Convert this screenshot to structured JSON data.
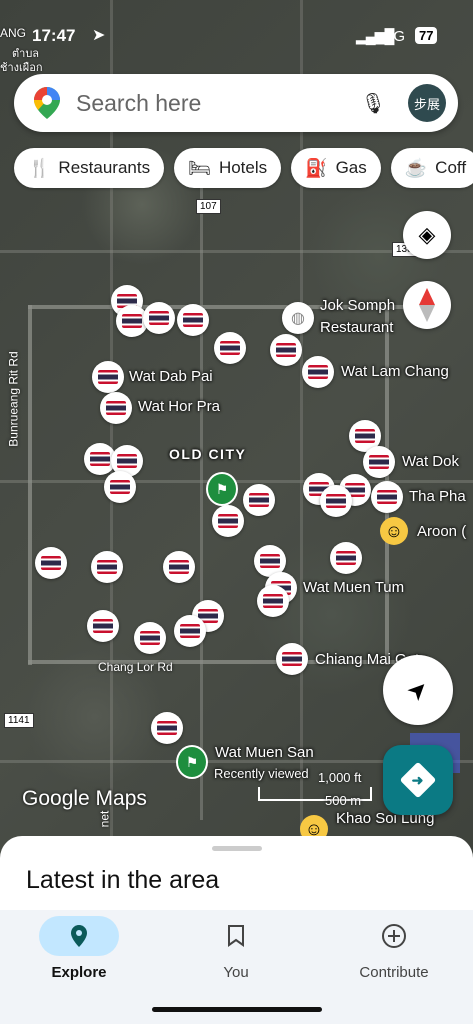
{
  "status_bar": {
    "time": "17:47",
    "carrier_top": "ANG",
    "carrier_thai1": "ตำบล",
    "carrier_thai2": "ช้างเผือก",
    "network": "5G",
    "battery": "77"
  },
  "search": {
    "placeholder": "Search here",
    "avatar_text": "步展"
  },
  "chips": [
    {
      "label": "Restaurants",
      "icon": "fork-knife-icon"
    },
    {
      "label": "Hotels",
      "icon": "bed-icon"
    },
    {
      "label": "Gas",
      "icon": "gas-pump-icon"
    },
    {
      "label": "Coff",
      "icon": "coffee-icon"
    }
  ],
  "map_labels": {
    "jok_1": "Jok Somph",
    "jok_2": "Restaurant",
    "wat_dab_pai": "Wat Dab Pai",
    "wat_lam_chang": "Wat Lam Chang",
    "wat_hor_pra": "Wat Hor Pra",
    "old_city": "OLD CITY",
    "wat_dok": "Wat Dok",
    "tha_pha": "Tha Pha",
    "aroon": "Aroon (",
    "wat_muen_tum": "Wat Muen Tum",
    "chiang_mai": "Chiang Mai Gate",
    "wat_muen_san": "Wat Muen San",
    "recently_viewed": "Recently viewed",
    "khao_soi": "Khao Soi Lung"
  },
  "road_labels": {
    "bunrueang": "Bunrueang Rit Rd",
    "chang_lor": "Chang Lor Rd",
    "net": "net"
  },
  "shields": {
    "r107": "107",
    "r1141": "1141",
    "r138": "138"
  },
  "scale": {
    "ft": "1,000 ft",
    "m": "500 m"
  },
  "watermark": "Google Maps",
  "sheet": {
    "title": "Latest in the area"
  },
  "nav": [
    {
      "label": "Explore",
      "icon": "pin-icon"
    },
    {
      "label": "You",
      "icon": "bookmark-icon"
    },
    {
      "label": "Contribute",
      "icon": "plus-circle-icon"
    }
  ]
}
